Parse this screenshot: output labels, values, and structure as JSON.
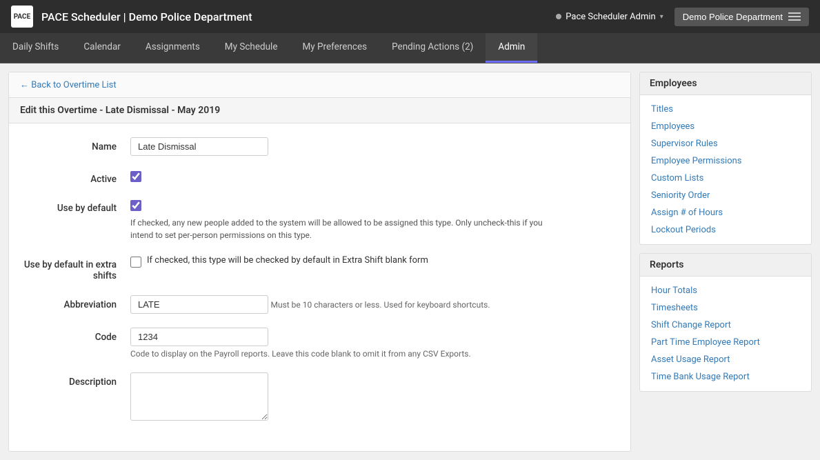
{
  "header": {
    "logo_text": "PACE",
    "title": "PACE Scheduler | Demo Police Department",
    "user_label": "Pace Scheduler Admin",
    "department_label": "Demo Police Department"
  },
  "nav": {
    "items": [
      {
        "key": "daily-shifts",
        "label": "Daily Shifts",
        "active": false
      },
      {
        "key": "calendar",
        "label": "Calendar",
        "active": false
      },
      {
        "key": "assignments",
        "label": "Assignments",
        "active": false
      },
      {
        "key": "my-schedule",
        "label": "My Schedule",
        "active": false
      },
      {
        "key": "my-preferences",
        "label": "My Preferences",
        "active": false
      },
      {
        "key": "pending-actions",
        "label": "Pending Actions (2)",
        "active": false
      },
      {
        "key": "admin",
        "label": "Admin",
        "active": true
      }
    ]
  },
  "breadcrumb": {
    "back_label": "← Back to Overtime List"
  },
  "page": {
    "edit_title": "Edit this Overtime - Late Dismissal - May 2019"
  },
  "form": {
    "name_label": "Name",
    "name_value": "Late Dismissal",
    "active_label": "Active",
    "use_by_default_label": "Use by default",
    "use_by_default_help": "If checked, any new people added to the system will be allowed to be assigned this type. Only uncheck-this if you intend to set per-person permissions on this type.",
    "use_by_default_in_extra_label": "Use by default in extra shifts",
    "use_by_default_in_extra_help": "If checked, this type will be checked by default in Extra Shift blank form",
    "abbreviation_label": "Abbreviation",
    "abbreviation_value": "LATE",
    "abbreviation_help": "Must be 10 characters or less. Used for keyboard shortcuts.",
    "code_label": "Code",
    "code_value": "1234",
    "code_help": "Code to display on the Payroll reports. Leave this code blank to omit it from any CSV Exports.",
    "description_label": "Description",
    "description_value": ""
  },
  "sidebar": {
    "employees_section": {
      "header": "Employees",
      "links": [
        {
          "key": "titles",
          "label": "Titles"
        },
        {
          "key": "employees",
          "label": "Employees"
        },
        {
          "key": "supervisor-rules",
          "label": "Supervisor Rules"
        },
        {
          "key": "employee-permissions",
          "label": "Employee Permissions"
        },
        {
          "key": "custom-lists",
          "label": "Custom Lists"
        },
        {
          "key": "seniority-order",
          "label": "Seniority Order"
        },
        {
          "key": "assign-hours",
          "label": "Assign # of Hours"
        },
        {
          "key": "lockout-periods",
          "label": "Lockout Periods"
        }
      ]
    },
    "reports_section": {
      "header": "Reports",
      "links": [
        {
          "key": "hour-totals",
          "label": "Hour Totals"
        },
        {
          "key": "timesheets",
          "label": "Timesheets"
        },
        {
          "key": "shift-change-report",
          "label": "Shift Change Report"
        },
        {
          "key": "part-time-report",
          "label": "Part Time Employee Report"
        },
        {
          "key": "asset-usage-report",
          "label": "Asset Usage Report"
        },
        {
          "key": "time-bank-report",
          "label": "Time Bank Usage Report"
        }
      ]
    }
  }
}
